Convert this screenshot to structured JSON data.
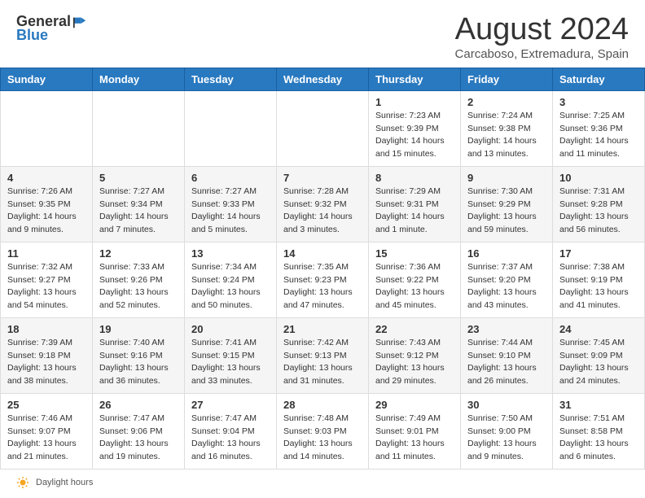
{
  "header": {
    "logo_general": "General",
    "logo_blue": "Blue",
    "main_title": "August 2024",
    "subtitle": "Carcaboso, Extremadura, Spain"
  },
  "calendar": {
    "days_of_week": [
      "Sunday",
      "Monday",
      "Tuesday",
      "Wednesday",
      "Thursday",
      "Friday",
      "Saturday"
    ],
    "weeks": [
      [
        {
          "day": "",
          "info": ""
        },
        {
          "day": "",
          "info": ""
        },
        {
          "day": "",
          "info": ""
        },
        {
          "day": "",
          "info": ""
        },
        {
          "day": "1",
          "info": "Sunrise: 7:23 AM\nSunset: 9:39 PM\nDaylight: 14 hours and 15 minutes."
        },
        {
          "day": "2",
          "info": "Sunrise: 7:24 AM\nSunset: 9:38 PM\nDaylight: 14 hours and 13 minutes."
        },
        {
          "day": "3",
          "info": "Sunrise: 7:25 AM\nSunset: 9:36 PM\nDaylight: 14 hours and 11 minutes."
        }
      ],
      [
        {
          "day": "4",
          "info": "Sunrise: 7:26 AM\nSunset: 9:35 PM\nDaylight: 14 hours and 9 minutes."
        },
        {
          "day": "5",
          "info": "Sunrise: 7:27 AM\nSunset: 9:34 PM\nDaylight: 14 hours and 7 minutes."
        },
        {
          "day": "6",
          "info": "Sunrise: 7:27 AM\nSunset: 9:33 PM\nDaylight: 14 hours and 5 minutes."
        },
        {
          "day": "7",
          "info": "Sunrise: 7:28 AM\nSunset: 9:32 PM\nDaylight: 14 hours and 3 minutes."
        },
        {
          "day": "8",
          "info": "Sunrise: 7:29 AM\nSunset: 9:31 PM\nDaylight: 14 hours and 1 minute."
        },
        {
          "day": "9",
          "info": "Sunrise: 7:30 AM\nSunset: 9:29 PM\nDaylight: 13 hours and 59 minutes."
        },
        {
          "day": "10",
          "info": "Sunrise: 7:31 AM\nSunset: 9:28 PM\nDaylight: 13 hours and 56 minutes."
        }
      ],
      [
        {
          "day": "11",
          "info": "Sunrise: 7:32 AM\nSunset: 9:27 PM\nDaylight: 13 hours and 54 minutes."
        },
        {
          "day": "12",
          "info": "Sunrise: 7:33 AM\nSunset: 9:26 PM\nDaylight: 13 hours and 52 minutes."
        },
        {
          "day": "13",
          "info": "Sunrise: 7:34 AM\nSunset: 9:24 PM\nDaylight: 13 hours and 50 minutes."
        },
        {
          "day": "14",
          "info": "Sunrise: 7:35 AM\nSunset: 9:23 PM\nDaylight: 13 hours and 47 minutes."
        },
        {
          "day": "15",
          "info": "Sunrise: 7:36 AM\nSunset: 9:22 PM\nDaylight: 13 hours and 45 minutes."
        },
        {
          "day": "16",
          "info": "Sunrise: 7:37 AM\nSunset: 9:20 PM\nDaylight: 13 hours and 43 minutes."
        },
        {
          "day": "17",
          "info": "Sunrise: 7:38 AM\nSunset: 9:19 PM\nDaylight: 13 hours and 41 minutes."
        }
      ],
      [
        {
          "day": "18",
          "info": "Sunrise: 7:39 AM\nSunset: 9:18 PM\nDaylight: 13 hours and 38 minutes."
        },
        {
          "day": "19",
          "info": "Sunrise: 7:40 AM\nSunset: 9:16 PM\nDaylight: 13 hours and 36 minutes."
        },
        {
          "day": "20",
          "info": "Sunrise: 7:41 AM\nSunset: 9:15 PM\nDaylight: 13 hours and 33 minutes."
        },
        {
          "day": "21",
          "info": "Sunrise: 7:42 AM\nSunset: 9:13 PM\nDaylight: 13 hours and 31 minutes."
        },
        {
          "day": "22",
          "info": "Sunrise: 7:43 AM\nSunset: 9:12 PM\nDaylight: 13 hours and 29 minutes."
        },
        {
          "day": "23",
          "info": "Sunrise: 7:44 AM\nSunset: 9:10 PM\nDaylight: 13 hours and 26 minutes."
        },
        {
          "day": "24",
          "info": "Sunrise: 7:45 AM\nSunset: 9:09 PM\nDaylight: 13 hours and 24 minutes."
        }
      ],
      [
        {
          "day": "25",
          "info": "Sunrise: 7:46 AM\nSunset: 9:07 PM\nDaylight: 13 hours and 21 minutes."
        },
        {
          "day": "26",
          "info": "Sunrise: 7:47 AM\nSunset: 9:06 PM\nDaylight: 13 hours and 19 minutes."
        },
        {
          "day": "27",
          "info": "Sunrise: 7:47 AM\nSunset: 9:04 PM\nDaylight: 13 hours and 16 minutes."
        },
        {
          "day": "28",
          "info": "Sunrise: 7:48 AM\nSunset: 9:03 PM\nDaylight: 13 hours and 14 minutes."
        },
        {
          "day": "29",
          "info": "Sunrise: 7:49 AM\nSunset: 9:01 PM\nDaylight: 13 hours and 11 minutes."
        },
        {
          "day": "30",
          "info": "Sunrise: 7:50 AM\nSunset: 9:00 PM\nDaylight: 13 hours and 9 minutes."
        },
        {
          "day": "31",
          "info": "Sunrise: 7:51 AM\nSunset: 8:58 PM\nDaylight: 13 hours and 6 minutes."
        }
      ]
    ]
  },
  "footer": {
    "daylight_hours_label": "Daylight hours"
  }
}
